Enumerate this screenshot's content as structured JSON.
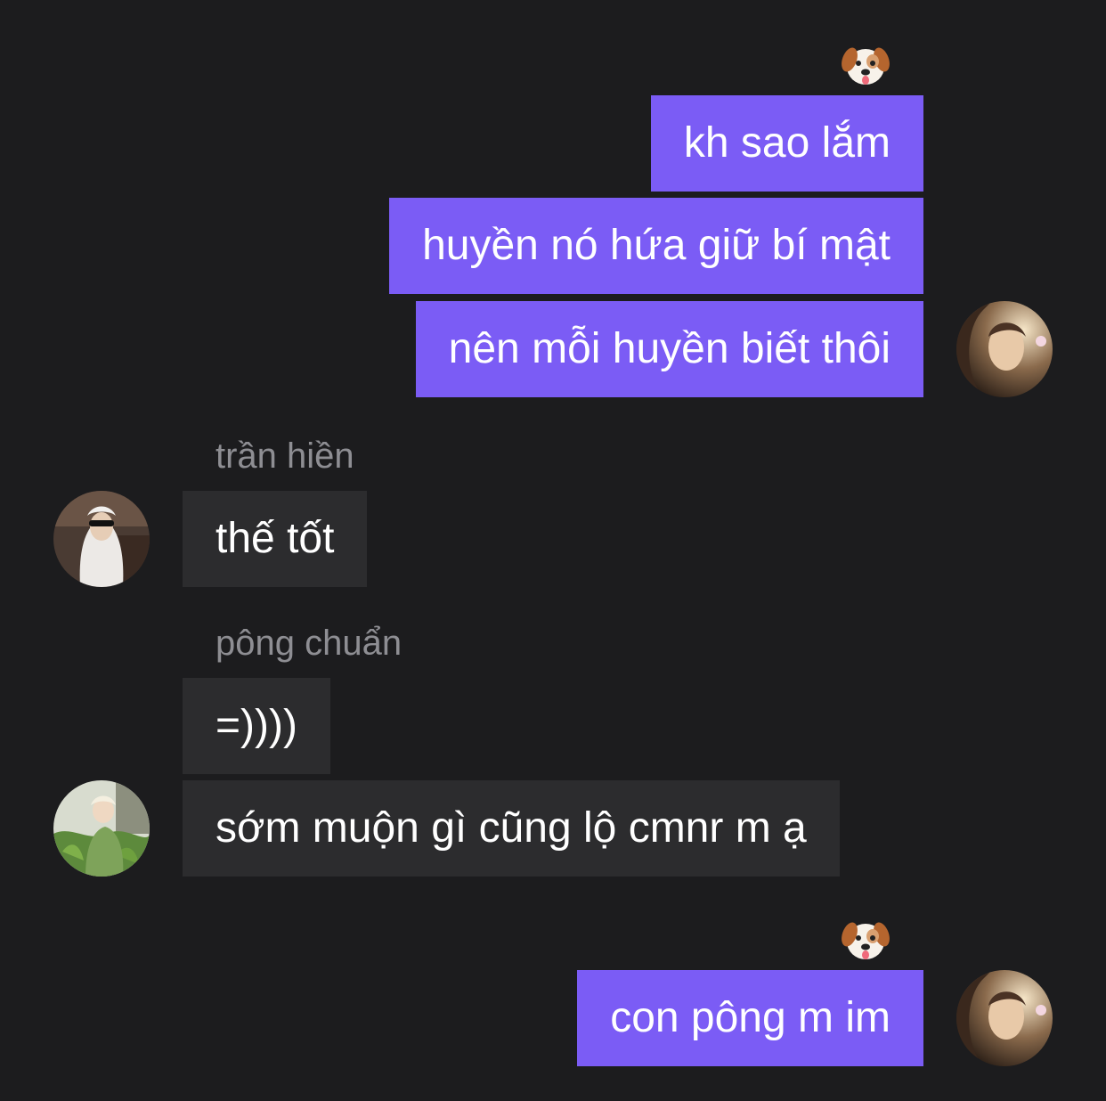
{
  "colors": {
    "background": "#1c1c1e",
    "outgoing_bubble": "#7b5cf5",
    "incoming_bubble": "#2c2c2e",
    "sender_name": "#8e8e93"
  },
  "messages": [
    {
      "direction": "outgoing",
      "text": "kh sao lắm",
      "reaction": "dog-face-emoji"
    },
    {
      "direction": "outgoing",
      "text": "huyền nó hứa giữ bí mật"
    },
    {
      "direction": "outgoing",
      "text": "nên mỗi huyền biết thôi",
      "avatar": "self-avatar"
    },
    {
      "direction": "incoming",
      "sender": "trần hiền",
      "text": "thế tốt",
      "avatar": "tran-hien-avatar"
    },
    {
      "direction": "incoming",
      "sender": "pông chuẩn",
      "text": "=))))"
    },
    {
      "direction": "incoming",
      "text": "sớm muộn gì cũng lộ cmnr m ạ",
      "avatar": "pong-chuan-avatar"
    },
    {
      "direction": "outgoing",
      "text": "con pông m im",
      "reaction": "dog-face-emoji",
      "avatar": "self-avatar"
    }
  ]
}
